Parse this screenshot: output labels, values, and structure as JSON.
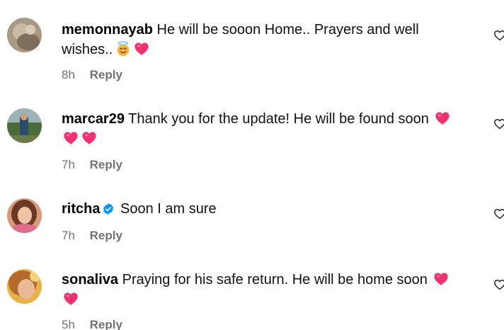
{
  "comments": [
    {
      "username": "memonnayab",
      "verified": false,
      "text": "He will be sooon Home.. Prayers and well wishes..",
      "emojis": [
        "smiling-face-with-halo",
        "heart"
      ],
      "time": "8h",
      "reply_label": "Reply"
    },
    {
      "username": "marcar29",
      "verified": false,
      "text": "Thank you for the update! He will be found soon",
      "emojis": [
        "heart",
        "heart",
        "heart"
      ],
      "time": "7h",
      "reply_label": "Reply"
    },
    {
      "username": "ritcha",
      "verified": true,
      "text": "Soon I am sure",
      "emojis": [],
      "time": "7h",
      "reply_label": "Reply"
    },
    {
      "username": "sonaliva",
      "verified": false,
      "text": "Praying for his safe return. He will be home soon",
      "emojis": [
        "heart",
        "heart"
      ],
      "time": "5h",
      "reply_label": "Reply"
    }
  ],
  "colors": {
    "meta_text": "#737373",
    "verified_badge": "#0095f6",
    "heart_emoji": "#f0326e"
  }
}
